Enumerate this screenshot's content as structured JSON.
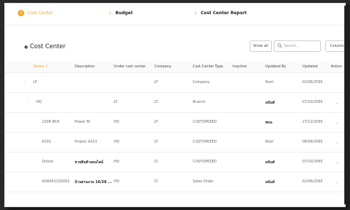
{
  "stepper": {
    "steps": [
      {
        "num": "1",
        "label": "Cost Center"
      },
      {
        "num": "2",
        "label": "Budget"
      },
      {
        "num": "3",
        "label": "Cost Center Report"
      }
    ]
  },
  "header": {
    "title": "Cost Center",
    "show_all": "Show all",
    "search_placeholder": "Search...",
    "columns": "Columns"
  },
  "table": {
    "columns": [
      "Name",
      "Description",
      "Under cost center",
      "Company",
      "Cost Center Type",
      "Inactive",
      "Updated By",
      "Updated",
      "Action"
    ],
    "rows": [
      {
        "caret": "›",
        "name": "LT",
        "description": "",
        "under": "",
        "company": "LT",
        "type": "Company",
        "inactive": "",
        "updated_by": "Root",
        "updated": "02/06/2565",
        "action": ""
      },
      {
        "caret": "›",
        "name": "HQ",
        "description": "",
        "under": "LT",
        "company": "LT",
        "type": "Branch",
        "inactive": "",
        "updated_by": "อนันต์",
        "updated": "07/10/2565",
        "action": "_"
      },
      {
        "caret": "",
        "name": "2208 BCR",
        "description": "Power BI",
        "under": "HQ",
        "company": "LT",
        "type": "CUSTOMIZED",
        "inactive": "",
        "updated_by": "พจน",
        "updated": "27/12/2565",
        "action": "_"
      },
      {
        "caret": "",
        "name": "A101",
        "description": "Project A101",
        "under": "HQ",
        "company": "LT",
        "type": "CUSTOMIZED",
        "inactive": "",
        "updated_by": "Root",
        "updated": "08/09/2565",
        "action": "_"
      },
      {
        "caret": "",
        "name": "Online",
        "description": "ขายสินค้าออนไลน์",
        "under": "HQ",
        "company": "LT",
        "type": "CUSTOMIZED",
        "inactive": "",
        "updated_by": "อนันต์",
        "updated": "07/10/2565",
        "action": "_"
      },
      {
        "caret": "",
        "name": "SO6401150001",
        "description": "บ้านสวนงาม 16/28 ...",
        "under": "HQ",
        "company": "LT",
        "type": "Sales Order",
        "inactive": "",
        "updated_by": "อนันต์",
        "updated": "02/06/2565",
        "action": "_"
      }
    ]
  },
  "colors": {
    "accent": "#f5a623"
  }
}
